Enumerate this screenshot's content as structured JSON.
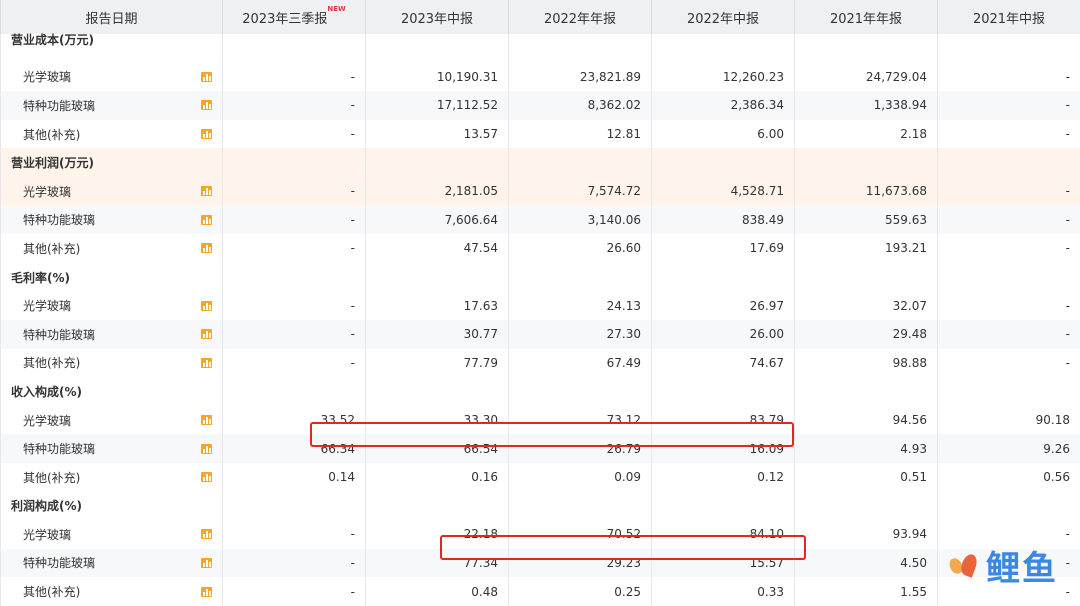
{
  "header": {
    "date_label": "报告日期",
    "columns": [
      "2023年三季报",
      "2023年中报",
      "2022年年报",
      "2022年中报",
      "2021年年报",
      "2021年中报"
    ],
    "new_badge": "NEW"
  },
  "sections": [
    {
      "title": "营业成本(万元)",
      "rows": [
        {
          "label": "光学玻璃",
          "values": [
            "-",
            "10,190.31",
            "23,821.89",
            "12,260.23",
            "24,729.04",
            "-"
          ]
        },
        {
          "label": "特种功能玻璃",
          "values": [
            "-",
            "17,112.52",
            "8,362.02",
            "2,386.34",
            "1,338.94",
            "-"
          ]
        },
        {
          "label": "其他(补充)",
          "values": [
            "-",
            "13.57",
            "12.81",
            "6.00",
            "2.18",
            "-"
          ]
        }
      ]
    },
    {
      "title": "营业利润(万元)",
      "rows": [
        {
          "label": "光学玻璃",
          "values": [
            "-",
            "2,181.05",
            "7,574.72",
            "4,528.71",
            "11,673.68",
            "-"
          ]
        },
        {
          "label": "特种功能玻璃",
          "values": [
            "-",
            "7,606.64",
            "3,140.06",
            "838.49",
            "559.63",
            "-"
          ]
        },
        {
          "label": "其他(补充)",
          "values": [
            "-",
            "47.54",
            "26.60",
            "17.69",
            "193.21",
            "-"
          ]
        }
      ]
    },
    {
      "title": "毛利率(%)",
      "rows": [
        {
          "label": "光学玻璃",
          "values": [
            "-",
            "17.63",
            "24.13",
            "26.97",
            "32.07",
            "-"
          ]
        },
        {
          "label": "特种功能玻璃",
          "values": [
            "-",
            "30.77",
            "27.30",
            "26.00",
            "29.48",
            "-"
          ]
        },
        {
          "label": "其他(补充)",
          "values": [
            "-",
            "77.79",
            "67.49",
            "74.67",
            "98.88",
            "-"
          ]
        }
      ]
    },
    {
      "title": "收入构成(%)",
      "rows": [
        {
          "label": "光学玻璃",
          "values": [
            "33.52",
            "33.30",
            "73.12",
            "83.79",
            "94.56",
            "90.18"
          ]
        },
        {
          "label": "特种功能玻璃",
          "values": [
            "66.34",
            "66.54",
            "26.79",
            "16.09",
            "4.93",
            "9.26"
          ]
        },
        {
          "label": "其他(补充)",
          "values": [
            "0.14",
            "0.16",
            "0.09",
            "0.12",
            "0.51",
            "0.56"
          ]
        }
      ]
    },
    {
      "title": "利润构成(%)",
      "rows": [
        {
          "label": "光学玻璃",
          "values": [
            "-",
            "22.18",
            "70.52",
            "84.10",
            "93.94",
            "-"
          ]
        },
        {
          "label": "特种功能玻璃",
          "values": [
            "-",
            "77.34",
            "29.23",
            "15.57",
            "4.50",
            "-"
          ]
        },
        {
          "label": "其他(补充)",
          "values": [
            "-",
            "0.48",
            "0.25",
            "0.33",
            "1.55",
            "-"
          ]
        }
      ]
    }
  ],
  "watermark": {
    "text": "鲤鱼"
  },
  "colors": {
    "highlight_row": "#fff4ec",
    "annotation_box": "#e0281f",
    "chart_icon": "#f6a623",
    "header_bg": "#eef0f3"
  }
}
